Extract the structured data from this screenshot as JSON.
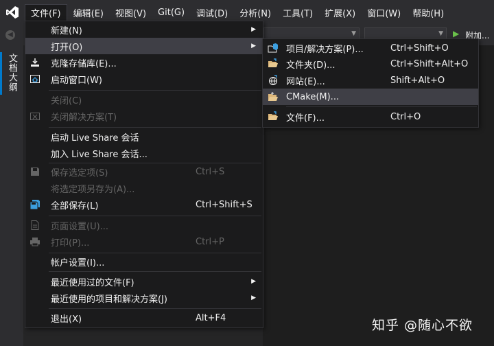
{
  "menubar": {
    "items": [
      "文件(F)",
      "编辑(E)",
      "视图(V)",
      "Git(G)",
      "调试(D)",
      "分析(N)",
      "工具(T)",
      "扩展(X)",
      "窗口(W)",
      "帮助(H)"
    ]
  },
  "toolbar": {
    "attach_label": "附加..."
  },
  "sidebar": {
    "tab_label": "文档大纲"
  },
  "file_menu": {
    "items": [
      {
        "label": "新建(N)",
        "shortcut": "",
        "submenu": true,
        "disabled": false,
        "icon": ""
      },
      {
        "label": "打开(O)",
        "shortcut": "",
        "submenu": true,
        "disabled": false,
        "icon": "",
        "highlighted": true
      },
      {
        "label": "克隆存储库(E)...",
        "shortcut": "",
        "submenu": false,
        "disabled": false,
        "icon": "clone-icon"
      },
      {
        "label": "启动窗口(W)",
        "shortcut": "",
        "submenu": false,
        "disabled": false,
        "icon": "home-window-icon"
      },
      {
        "label": "关闭(C)",
        "shortcut": "",
        "submenu": false,
        "disabled": true,
        "icon": ""
      },
      {
        "label": "关闭解决方案(T)",
        "shortcut": "",
        "submenu": false,
        "disabled": true,
        "icon": "close-solution-icon"
      },
      {
        "label": "启动 Live Share 会话",
        "shortcut": "",
        "submenu": false,
        "disabled": false,
        "icon": ""
      },
      {
        "label": "加入 Live Share 会话...",
        "shortcut": "",
        "submenu": false,
        "disabled": false,
        "icon": ""
      },
      {
        "label": "保存选定项(S)",
        "shortcut": "Ctrl+S",
        "submenu": false,
        "disabled": true,
        "icon": "save-icon"
      },
      {
        "label": "将选定项另存为(A)...",
        "shortcut": "",
        "submenu": false,
        "disabled": true,
        "icon": ""
      },
      {
        "label": "全部保存(L)",
        "shortcut": "Ctrl+Shift+S",
        "submenu": false,
        "disabled": false,
        "icon": "save-all-icon"
      },
      {
        "label": "页面设置(U)...",
        "shortcut": "",
        "submenu": false,
        "disabled": true,
        "icon": "page-setup-icon"
      },
      {
        "label": "打印(P)...",
        "shortcut": "Ctrl+P",
        "submenu": false,
        "disabled": true,
        "icon": "print-icon"
      },
      {
        "label": "帐户设置(I)...",
        "shortcut": "",
        "submenu": false,
        "disabled": false,
        "icon": ""
      },
      {
        "label": "最近使用过的文件(F)",
        "shortcut": "",
        "submenu": true,
        "disabled": false,
        "icon": ""
      },
      {
        "label": "最近使用的项目和解决方案(J)",
        "shortcut": "",
        "submenu": true,
        "disabled": false,
        "icon": ""
      },
      {
        "label": "退出(X)",
        "shortcut": "Alt+F4",
        "submenu": false,
        "disabled": false,
        "icon": ""
      }
    ]
  },
  "open_submenu": {
    "items": [
      {
        "label": "项目/解决方案(P)...",
        "shortcut": "Ctrl+Shift+O",
        "icon": "project-solution-icon"
      },
      {
        "label": "文件夹(D)...",
        "shortcut": "Ctrl+Shift+Alt+O",
        "icon": "folder-icon"
      },
      {
        "label": "网站(E)...",
        "shortcut": "Shift+Alt+O",
        "icon": "website-icon"
      },
      {
        "label": "CMake(M)...",
        "shortcut": "",
        "icon": "cmake-folder-icon",
        "highlighted": true
      },
      {
        "label": "文件(F)...",
        "shortcut": "Ctrl+O",
        "icon": "open-file-icon"
      }
    ]
  },
  "watermark": {
    "text": "知乎 @随心不欲"
  },
  "colors": {
    "accent": "#007acc",
    "menu_bg": "#1b1b1c",
    "highlight": "#3f3f46",
    "disabled": "#656565"
  }
}
